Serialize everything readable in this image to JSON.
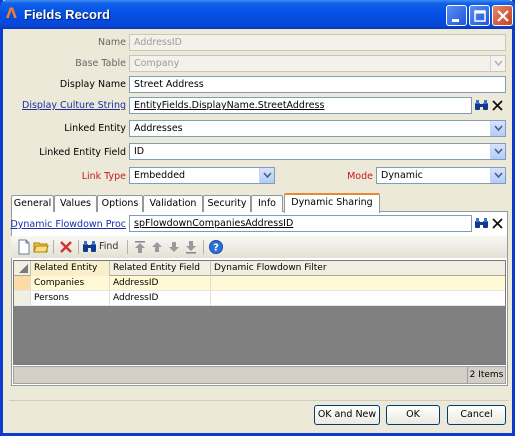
{
  "window": {
    "title": "Fields Record"
  },
  "form": {
    "name_label": "Name",
    "name_value": "AddressID",
    "base_table_label": "Base Table",
    "base_table_value": "Company",
    "display_name_label": "Display Name",
    "display_name_value": "Street Address",
    "display_culture_label": "Display Culture String",
    "display_culture_value": "EntityFields.DisplayName.StreetAddress",
    "linked_entity_label": "Linked Entity",
    "linked_entity_value": "Addresses",
    "linked_entity_field_label": "Linked Entity Field",
    "linked_entity_field_value": "ID",
    "link_type_label": "Link Type",
    "link_type_value": "Embedded",
    "mode_label": "Mode",
    "mode_value": "Dynamic"
  },
  "tabs": [
    {
      "label": "General"
    },
    {
      "label": "Values"
    },
    {
      "label": "Options"
    },
    {
      "label": "Validation"
    },
    {
      "label": "Security"
    },
    {
      "label": "Info"
    },
    {
      "label": "Dynamic Sharing"
    }
  ],
  "dynamic_sharing": {
    "flowdown_label": "Dynamic Flowdown Proc",
    "flowdown_value": "spFlowdownCompaniesAddressID"
  },
  "toolbar": {
    "find_label": "Find",
    "icons": [
      "new-icon",
      "open-icon",
      "delete-icon",
      "binoculars-icon",
      "move-top-icon",
      "move-up-icon",
      "move-down-icon",
      "move-bottom-icon",
      "help-icon"
    ]
  },
  "grid": {
    "columns": [
      "Related Entity",
      "Related Entity Field",
      "Dynamic Flowdown Filter"
    ],
    "rows": [
      {
        "entity": "Companies",
        "field": "AddressID",
        "filter": ""
      },
      {
        "entity": "Persons",
        "field": "AddressID",
        "filter": ""
      }
    ],
    "count_text": "2 Items"
  },
  "buttons": {
    "ok_new": "OK and New",
    "ok": "OK",
    "cancel": "Cancel"
  },
  "colors": {
    "title_bar": "#0250e4",
    "link": "#1a2fa0",
    "required": "#c21d1d",
    "selected_row": "#fff9d6",
    "active_tab_accent": "#e68b2c"
  }
}
